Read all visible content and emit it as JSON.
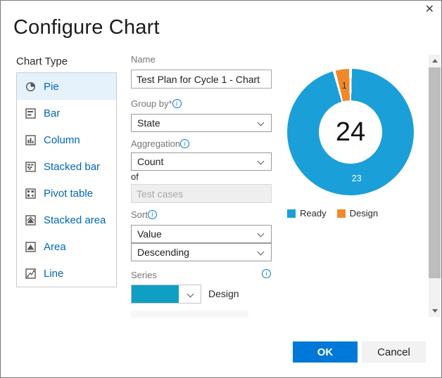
{
  "dialog": {
    "title": "Configure Chart"
  },
  "icons": {
    "close": "✕"
  },
  "chart_type_panel": {
    "label": "Chart Type",
    "items": [
      {
        "label": "Pie",
        "selected": true
      },
      {
        "label": "Bar",
        "selected": false
      },
      {
        "label": "Column",
        "selected": false
      },
      {
        "label": "Stacked bar",
        "selected": false
      },
      {
        "label": "Pivot table",
        "selected": false
      },
      {
        "label": "Stacked area",
        "selected": false
      },
      {
        "label": "Area",
        "selected": false
      },
      {
        "label": "Line",
        "selected": false
      }
    ]
  },
  "form": {
    "name_label": "Name",
    "name_value": "Test Plan for Cycle 1 - Chart",
    "group_by_label": "Group by*",
    "group_by_value": "State",
    "aggregation_label": "Aggregation",
    "aggregation_value": "Count",
    "of_label": "of",
    "of_value": "Test cases",
    "sort_label": "Sort",
    "sort_value": "Value",
    "sort_direction": "Descending",
    "series_label": "Series",
    "series_swatch_color": "#0f9fc5",
    "series_name": "Design"
  },
  "chart_data": {
    "type": "pie",
    "donut": true,
    "title": "",
    "categories": [
      "Ready",
      "Design"
    ],
    "values": [
      23,
      1
    ],
    "colors": [
      "#1b9fd9",
      "#f1892a"
    ],
    "slice_label_colors": [
      "#ffffff",
      "#333333"
    ],
    "center_total": "24",
    "total": 24,
    "start_angle": 0,
    "legend_position": "bottom"
  },
  "footer": {
    "ok_label": "OK",
    "cancel_label": "Cancel"
  }
}
